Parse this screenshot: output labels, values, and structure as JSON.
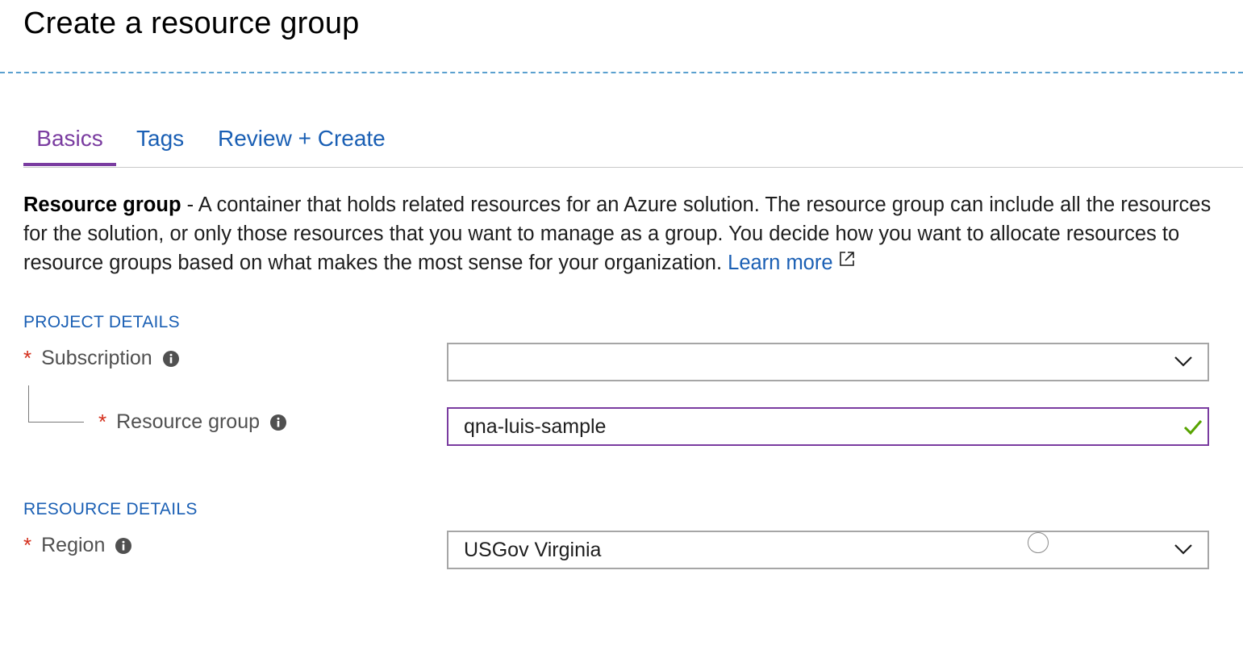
{
  "page": {
    "title": "Create a resource group"
  },
  "tabs": [
    {
      "label": "Basics",
      "active": true
    },
    {
      "label": "Tags",
      "active": false
    },
    {
      "label": "Review + Create",
      "active": false
    }
  ],
  "description": {
    "bold": "Resource group",
    "text": " - A container that holds related resources for an Azure solution. The resource group can include all the resources for the solution, or only those resources that you want to manage as a group. You decide how you want to allocate resources to resource groups based on what makes the most sense for your organization. ",
    "link": "Learn more",
    "link_icon": "external-link-icon"
  },
  "project_details": {
    "heading": "PROJECT DETAILS",
    "subscription": {
      "required_mark": "*",
      "label": "Subscription",
      "value": "",
      "icon": "info-icon"
    },
    "resource_group": {
      "required_mark": "*",
      "label": "Resource group",
      "value": "qna-luis-sample",
      "icon": "info-icon",
      "valid_icon": "checkmark-icon"
    }
  },
  "resource_details": {
    "heading": "RESOURCE DETAILS",
    "region": {
      "required_mark": "*",
      "label": "Region",
      "value": "USGov Virginia",
      "icon": "info-icon"
    }
  },
  "colors": {
    "accent_purple": "#7a3ca0",
    "link_blue": "#1a5fb4",
    "required_red": "#d42f1c",
    "valid_green": "#57a300"
  }
}
